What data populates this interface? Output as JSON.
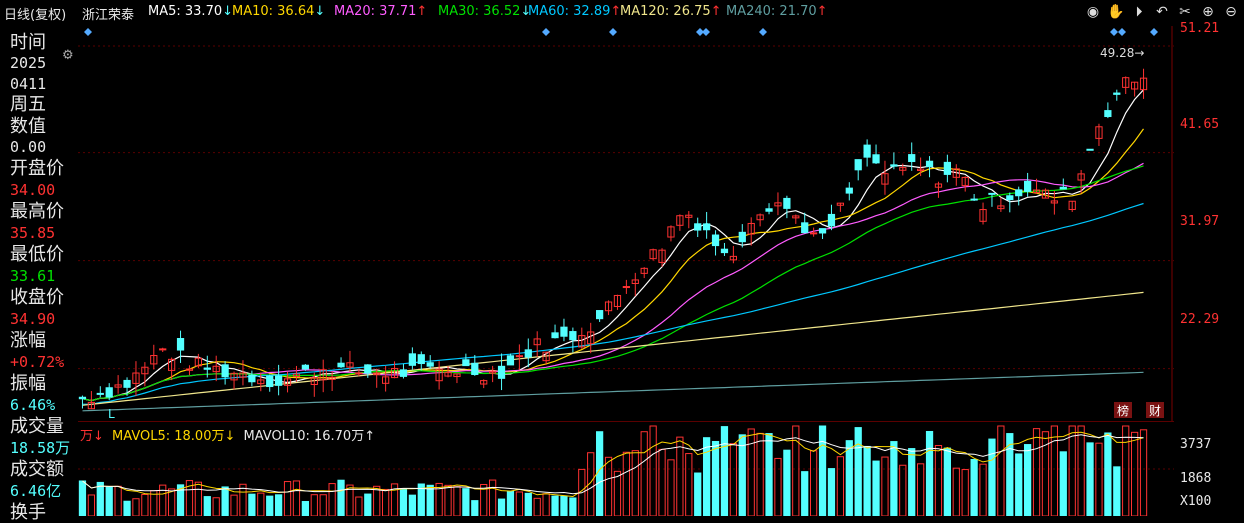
{
  "header": {
    "period": "日线(复权)",
    "stock_name": "浙江荣泰",
    "ma": [
      {
        "label": "MA5: 33.70",
        "arrow": "↓",
        "color": "#ffffff"
      },
      {
        "label": "MA10: 36.64",
        "arrow": "↓",
        "color": "#ffd700"
      },
      {
        "label": "MA20: 37.71",
        "arrow": "↑",
        "color": "#ff5cff"
      },
      {
        "label": "MA30: 36.52",
        "arrow": "↓",
        "color": "#00e000"
      },
      {
        "label": "MA60: 32.89",
        "arrow": "↑",
        "color": "#00c8ff"
      },
      {
        "label": "MA120: 26.75",
        "arrow": "↑",
        "color": "#f0e68c"
      },
      {
        "label": "MA240: 21.70",
        "arrow": "↑",
        "color": "#5f9ea0"
      }
    ],
    "toolbar_icons": [
      "eye-icon",
      "hand-icon",
      "play-icon",
      "undo-icon",
      "scissors-icon",
      "zoom-in-icon",
      "zoom-out-icon"
    ]
  },
  "info": {
    "time_label": "时间",
    "year": "2025",
    "date": "0411",
    "weekday": "周五",
    "value_label": "数值",
    "value": "0.00",
    "open_label": "开盘价",
    "open": "34.00",
    "high_label": "最高价",
    "high": "35.85",
    "low_label": "最低价",
    "low": "33.61",
    "close_label": "收盘价",
    "close": "34.90",
    "change_label": "涨幅",
    "change": "+0.72%",
    "amplitude_label": "振幅",
    "amplitude": "6.46%",
    "volume_label": "成交量",
    "volume": "18.58万",
    "turnover_label": "成交额",
    "turnover": "6.46亿",
    "hand_label": "换手"
  },
  "price_axis": [
    "51.21",
    "41.65",
    "31.97",
    "22.29"
  ],
  "volume_axis": [
    "3737",
    "1868",
    "X100"
  ],
  "max_marker": "49.28",
  "l_marker": "L",
  "badges": [
    "榜",
    "财"
  ],
  "volume_header": {
    "unit": "万↓",
    "mavol5": "MAVOL5: 18.00万↓",
    "mavol10": "MAVOL10: 16.70万↑"
  },
  "colors": {
    "up": "#ff3232",
    "down": "#54ffff",
    "axis_red": "#ff3232",
    "grid": "#5a0000"
  },
  "chart_data": {
    "type": "candlestick",
    "ylim": [
      17.5,
      53.0
    ],
    "volume_ylim": [
      0,
      3737
    ],
    "count": 120,
    "close_path": [
      [
        0,
        19.6
      ],
      [
        8,
        21.0
      ],
      [
        14,
        24.0
      ],
      [
        20,
        22.5
      ],
      [
        28,
        21.8
      ],
      [
        34,
        21.2
      ],
      [
        42,
        22.3
      ],
      [
        48,
        22.0
      ],
      [
        54,
        21.9
      ],
      [
        60,
        22.1
      ],
      [
        66,
        22.3
      ],
      [
        72,
        21.8
      ],
      [
        78,
        24.2
      ],
      [
        84,
        25.0
      ],
      [
        90,
        26.8
      ],
      [
        95,
        30.5
      ],
      [
        100,
        33.0
      ],
      [
        104,
        36.5
      ],
      [
        108,
        35.0
      ],
      [
        112,
        31.8
      ],
      [
        116,
        36.0
      ],
      [
        120,
        37.5
      ],
      [
        124,
        35.8
      ],
      [
        128,
        33.5
      ],
      [
        132,
        37.0
      ],
      [
        136,
        41.2
      ],
      [
        140,
        39.5
      ],
      [
        144,
        40.5
      ],
      [
        148,
        39.5
      ],
      [
        152,
        40.0
      ],
      [
        156,
        36.8
      ],
      [
        160,
        37.8
      ],
      [
        164,
        38.5
      ],
      [
        168,
        37.5
      ],
      [
        172,
        38.0
      ],
      [
        176,
        44.0
      ],
      [
        180,
        47.5
      ],
      [
        184,
        48.5
      ]
    ]
  }
}
